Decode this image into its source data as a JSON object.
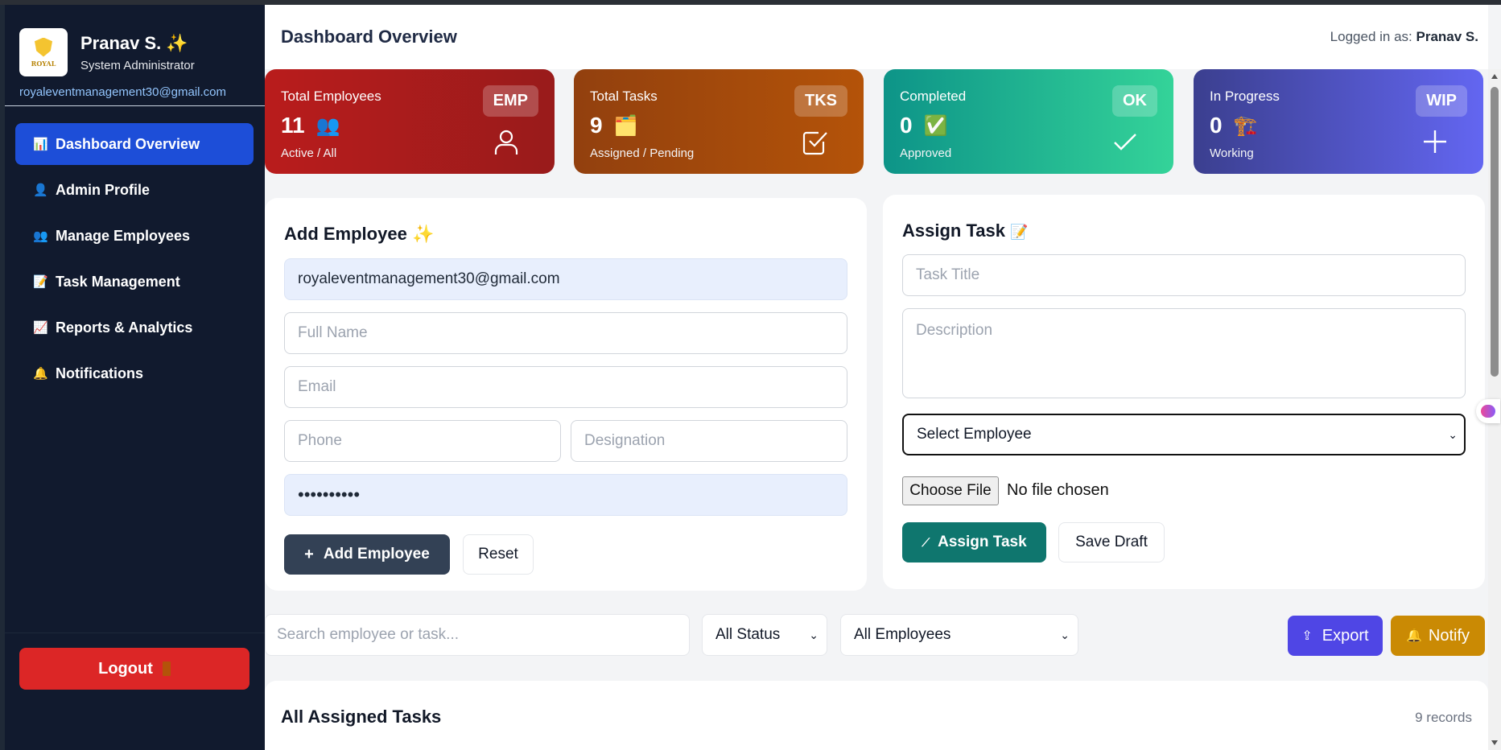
{
  "sidebar": {
    "name": "Pranav S.",
    "sparkle": "✨",
    "role": "System Administrator",
    "email": "royaleventmanagement30@gmail.com",
    "logo_text": "ROYAL",
    "nav": [
      {
        "icon": "📊",
        "label": "Dashboard Overview",
        "active": true
      },
      {
        "icon": "👤",
        "label": "Admin Profile"
      },
      {
        "icon": "👥",
        "label": "Manage Employees"
      },
      {
        "icon": "📝",
        "label": "Task Management"
      },
      {
        "icon": "📈",
        "label": "Reports & Analytics"
      },
      {
        "icon": "🔔",
        "label": "Notifications"
      }
    ],
    "logout_label": "Logout"
  },
  "header": {
    "title": "Dashboard Overview",
    "logged_prefix": "Logged in as:",
    "logged_user": "Pranav S."
  },
  "stats": [
    {
      "label": "Total Employees",
      "value": "11",
      "emoji": "👥",
      "sub": "Active / All",
      "badge": "EMP",
      "icon": "user-icon",
      "color": "#b91c1c"
    },
    {
      "label": "Total Tasks",
      "value": "9",
      "emoji": "🗂️",
      "sub": "Assigned / Pending",
      "badge": "TKS",
      "icon": "checkbox-icon",
      "color": "#b45309"
    },
    {
      "label": "Completed",
      "value": "0",
      "emoji": "✅",
      "sub": "Approved",
      "badge": "OK",
      "icon": "check-icon",
      "color": "#10b981"
    },
    {
      "label": "In Progress",
      "value": "0",
      "emoji": "🏗️",
      "sub": "Working",
      "badge": "WIP",
      "icon": "plus-icon",
      "color": "#6366f1"
    }
  ],
  "add_employee": {
    "title": "Add Employee",
    "emoji": "✨",
    "username_value": "royaleventmanagement30@gmail.com",
    "fullname_placeholder": "Full Name",
    "email_placeholder": "Email",
    "phone_placeholder": "Phone",
    "designation_placeholder": "Designation",
    "password_value": "••••••••••",
    "add_label": "Add Employee",
    "reset_label": "Reset"
  },
  "assign_task": {
    "title": "Assign Task",
    "emoji": "📝",
    "title_placeholder": "Task Title",
    "desc_placeholder": "Description",
    "select_value": "Select Employee",
    "file_button": "Choose File",
    "file_status": "No file chosen",
    "assign_label": "Assign Task",
    "draft_label": "Save Draft"
  },
  "filters": {
    "search_placeholder": "Search employee or task...",
    "status_value": "All Status",
    "employee_value": "All Employees",
    "export_label": "Export",
    "notify_label": "Notify"
  },
  "tasks": {
    "title": "All Assigned Tasks",
    "count": "9 records"
  }
}
